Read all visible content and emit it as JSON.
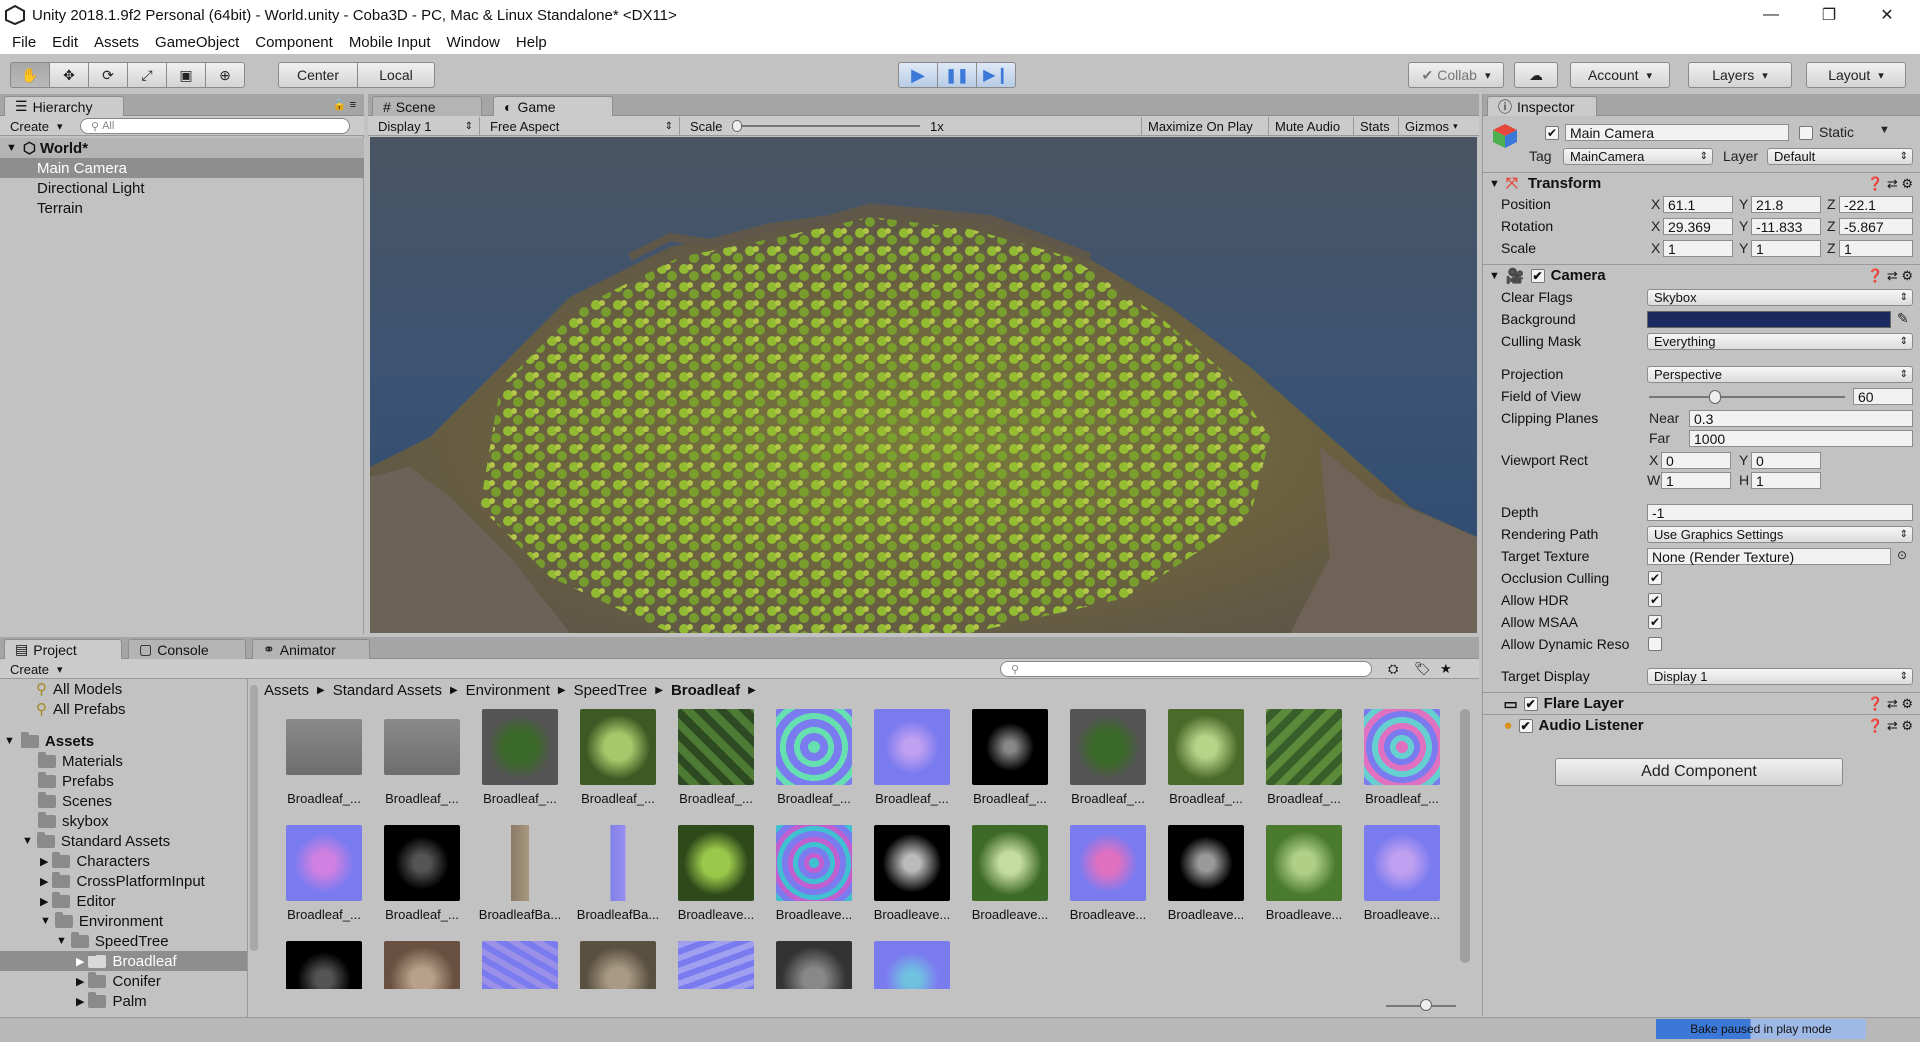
{
  "window": {
    "title": "Unity 2018.1.9f2 Personal (64bit) - World.unity - Coba3D - PC, Mac & Linux Standalone* <DX11>",
    "minimize": "—",
    "restore": "❐",
    "close": "✕"
  },
  "menu": [
    "File",
    "Edit",
    "Assets",
    "GameObject",
    "Component",
    "Mobile Input",
    "Window",
    "Help"
  ],
  "toolbar": {
    "pivot": "Center",
    "space": "Local",
    "collab": "Collab",
    "account": "Account",
    "layers": "Layers",
    "layout": "Layout"
  },
  "hierarchy": {
    "tab": "Hierarchy",
    "create": "Create",
    "search_placeholder": "All",
    "scene": "World*",
    "items": [
      "Main Camera",
      "Directional Light",
      "Terrain"
    ],
    "selected": "Main Camera"
  },
  "views": {
    "scene_tab": "Scene",
    "game_tab": "Game",
    "display": "Display 1",
    "aspect": "Free Aspect",
    "scale_label": "Scale",
    "scale_value": "1x",
    "maximize": "Maximize On Play",
    "mute": "Mute Audio",
    "stats": "Stats",
    "gizmos": "Gizmos"
  },
  "inspector": {
    "tab": "Inspector",
    "object_name": "Main Camera",
    "static": "Static",
    "tag_label": "Tag",
    "tag": "MainCamera",
    "layer_label": "Layer",
    "layer": "Default",
    "transform": {
      "title": "Transform",
      "position_label": "Position",
      "rotation_label": "Rotation",
      "scale_label": "Scale",
      "position": {
        "x": "61.1",
        "y": "21.8",
        "z": "-22.1"
      },
      "rotation": {
        "x": "29.369",
        "y": "-11.833",
        "z": "-5.867"
      },
      "scale": {
        "x": "1",
        "y": "1",
        "z": "1"
      }
    },
    "camera": {
      "title": "Camera",
      "clear_flags_label": "Clear Flags",
      "clear_flags": "Skybox",
      "background_label": "Background",
      "background_color": "#1a2a5e",
      "culling_mask_label": "Culling Mask",
      "culling_mask": "Everything",
      "projection_label": "Projection",
      "projection": "Perspective",
      "fov_label": "Field of View",
      "fov": "60",
      "clipping_label": "Clipping Planes",
      "near_label": "Near",
      "near": "0.3",
      "far_label": "Far",
      "far": "1000",
      "viewport_label": "Viewport Rect",
      "vx": "0",
      "vy": "0",
      "vw": "1",
      "vh": "1",
      "depth_label": "Depth",
      "depth": "-1",
      "rendering_path_label": "Rendering Path",
      "rendering_path": "Use Graphics Settings",
      "target_texture_label": "Target Texture",
      "target_texture": "None (Render Texture)",
      "occlusion_label": "Occlusion Culling",
      "hdr_label": "Allow HDR",
      "msaa_label": "Allow MSAA",
      "dyn_label": "Allow Dynamic Reso",
      "target_display_label": "Target Display",
      "target_display": "Display 1"
    },
    "flare": "Flare Layer",
    "audio": "Audio Listener",
    "add_component": "Add Component"
  },
  "project": {
    "tabs": [
      "Project",
      "Console",
      "Animator"
    ],
    "create": "Create",
    "favorites": [
      "All Models",
      "All Prefabs"
    ],
    "tree": [
      "Assets",
      "Materials",
      "Prefabs",
      "Scenes",
      "skybox",
      "Standard Assets",
      "Characters",
      "CrossPlatformInput",
      "Editor",
      "Environment",
      "SpeedTree",
      "Broadleaf",
      "Conifer",
      "Palm"
    ],
    "breadcrumb": [
      "Assets",
      "Standard Assets",
      "Environment",
      "SpeedTree",
      "Broadleaf"
    ],
    "row1": [
      "Broadleaf_...",
      "Broadleaf_...",
      "Broadleaf_...",
      "Broadleaf_...",
      "Broadleaf_...",
      "Broadleaf_...",
      "Broadleaf_...",
      "Broadleaf_...",
      "Broadleaf_...",
      "Broadleaf_...",
      "Broadleaf_...",
      "Broadleaf_..."
    ],
    "row2": [
      "Broadleaf_...",
      "Broadleaf_...",
      "BroadleafBa...",
      "BroadleafBa...",
      "Broadleave...",
      "Broadleave...",
      "Broadleave...",
      "Broadleave...",
      "Broadleave...",
      "Broadleave...",
      "Broadleave...",
      "Broadleave..."
    ]
  },
  "status": {
    "bake": "Bake paused in play mode"
  },
  "colors": {
    "play_blue": "#3b78d8",
    "normal_map": "#7b7bf0",
    "leaf_green": "#8cc63f"
  }
}
